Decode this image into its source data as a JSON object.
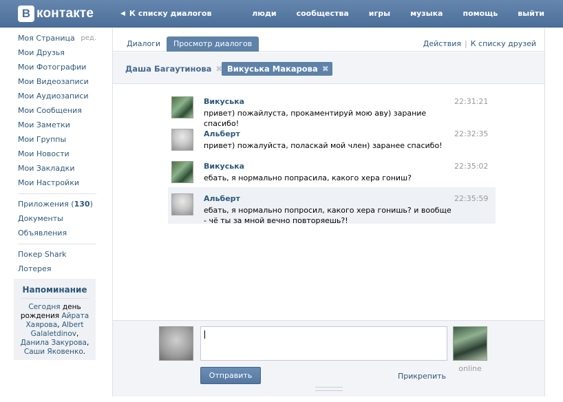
{
  "header": {
    "logo_letter": "В",
    "logo_text": "контакте",
    "back_link": "К списку диалогов",
    "nav": [
      "люди",
      "сообщества",
      "игры",
      "музыка",
      "помощь",
      "выйти"
    ]
  },
  "sidebar": {
    "items": [
      {
        "label": "Моя Страница",
        "extra": "ред."
      },
      {
        "label": "Мои Друзья"
      },
      {
        "label": "Мои Фотографии"
      },
      {
        "label": "Мои Видеозаписи"
      },
      {
        "label": "Мои Аудиозаписи"
      },
      {
        "label": "Мои Сообщения"
      },
      {
        "label": "Мои Заметки"
      },
      {
        "label": "Мои Группы"
      },
      {
        "label": "Мои Новости"
      },
      {
        "label": "Мои Закладки"
      },
      {
        "label": "Мои Настройки"
      }
    ],
    "apps_label": "Приложения (",
    "apps_count": "130",
    "apps_close": ")",
    "docs": "Документы",
    "ads": "Объявления",
    "poker": "Покер Shark",
    "lottery": "Лотерея"
  },
  "reminder": {
    "title": "Напоминание",
    "today": "Сегодня",
    "day_of": " день рождения ",
    "name1": "Айрата Хаярова",
    "comma1": ", ",
    "name2": "Albert Galaletdinov",
    "comma2": ", ",
    "name3": "Данила Закурова",
    "comma3": ", ",
    "name4": "Саши Яковенко",
    "end": "."
  },
  "tabs": {
    "dialogs": "Диалоги",
    "view": "Просмотр диалогов",
    "actions": "Действия",
    "separator": "|",
    "friends": "К списку друзей"
  },
  "people": {
    "p1": "Даша Багаутинова",
    "p2": "Викуська Макарова",
    "close": "✖"
  },
  "messages": [
    {
      "name": "Викуська",
      "time": "22:31:21",
      "text": "привет) пожайлуста, прокаментируй мою аву) зарание спасибо!"
    },
    {
      "name": "Альберт",
      "time": "22:32:35",
      "text": "привет) пожалуйста, полаcкай мой член) заранее спасибо!"
    },
    {
      "name": "Викуська",
      "time": "22:35:02",
      "text": "ебать, я нормально попрасила, какого хера гониш?"
    },
    {
      "name": "Альберт",
      "time": "22:35:59",
      "text": "ебать, я нормально попросил, какого хера гонишь? и вообще - чё ты за мной вечно повторяешь?!"
    }
  ],
  "compose": {
    "send": "Отправить",
    "attach": "Прикрепить",
    "online": "online"
  }
}
